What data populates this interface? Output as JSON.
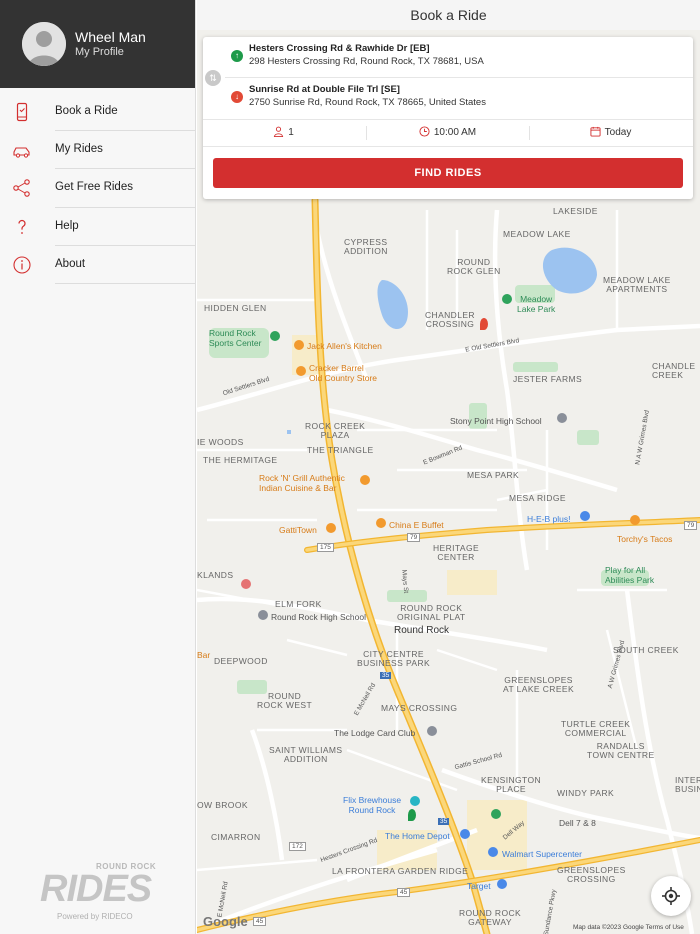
{
  "profile": {
    "name": "Wheel Man",
    "subtitle": "My Profile"
  },
  "menu": {
    "items": [
      {
        "label": "Book a Ride",
        "icon": "phone-icon"
      },
      {
        "label": "My Rides",
        "icon": "car-icon"
      },
      {
        "label": "Get Free Rides",
        "icon": "share-icon"
      },
      {
        "label": "Help",
        "icon": "question-icon"
      },
      {
        "label": "About",
        "icon": "info-icon"
      }
    ]
  },
  "brand": {
    "small": "ROUND ROCK",
    "big": "RIDES",
    "powered": "Powered by RIDECO"
  },
  "header": {
    "title": "Book a Ride"
  },
  "ride": {
    "pickup": {
      "title": "Hesters Crossing Rd & Rawhide Dr [EB]",
      "address": "298 Hesters Crossing Rd, Round Rock, TX 78681, USA",
      "color": "#1e9a4a"
    },
    "dropoff": {
      "title": "Sunrise Rd at Double File Trl [SE]",
      "address": "2750 Sunrise Rd, Round Rock, TX 78665, United States",
      "color": "#e24a36"
    },
    "passengers": "1",
    "time": "10:00 AM",
    "date": "Today",
    "find_label": "FIND RIDES"
  },
  "map": {
    "labels": {
      "lakeside": "LAKESIDE",
      "meadow_lake": "MEADOW LAKE",
      "cypress": "CYPRESS\nADDITION",
      "round_rock_glen": "ROUND\nROCK GLEN",
      "meadow_lake_apts": "MEADOW LAKE\nAPARTMENTS",
      "hidden_glen": "HIDDEN GLEN",
      "chandler_crossing": "CHANDLER\nCROSSING",
      "chandler_creek": "CHANDLE\nCREEK",
      "jester_farms": "JESTER FARMS",
      "ie_woods": "IE WOODS",
      "rock_creek_plaza": "ROCK CREEK\nPLAZA",
      "the_triangle": "THE TRIANGLE",
      "the_hermitage": "THE HERMITAGE",
      "mesa_park": "MESA PARK",
      "mesa_ridge": "MESA RIDGE",
      "heritage_center": "HERITAGE\nCENTER",
      "klands": "KLANDS",
      "elm_fork": "ELM FORK",
      "round_rock_original": "ROUND ROCK\nORIGINAL PLAT",
      "round_rock": "Round Rock",
      "deepwood": "DEEPWOOD",
      "city_centre": "CITY CENTRE\nBUSINESS PARK",
      "south_creek": "SOUTH CREEK",
      "greenslopes": "GREENSLOPES\nAT LAKE CREEK",
      "round_rock_west": "ROUND\nROCK WEST",
      "mays_crossing": "MAYS CROSSING",
      "turtle_creek": "TURTLE CREEK\nCOMMERCIAL",
      "saint_williams": "SAINT WILLIAMS\nADDITION",
      "randalls": "RANDALLS\nTOWN CENTRE",
      "kensington": "KENSINGTON\nPLACE",
      "windy_park": "WINDY PARK",
      "interchange": "INTERCHA\nBUSINESS",
      "ow_brook": "OW BROOK",
      "cimarron": "CIMARRON",
      "la_frontera": "LA FRONTERA GARDEN RIDGE",
      "greenslopes_crossing": "GREENSLOPES\nCROSSING",
      "round_rock_gateway": "ROUND ROCK\nGATEWAY"
    },
    "pois": {
      "round_rock_sports": "Round Rock\nSports Center",
      "jack_allens": "Jack Allen's Kitchen",
      "cracker_barrel": "Cracker Barrel\nOld Country Store",
      "meadow_lake_park": "Meadow\nLake Park",
      "stony_point": "Stony Point High School",
      "rock_n_grill": "Rock 'N' Grill Authentic\nIndian Cuisine & Bar",
      "heb": "H-E-B plus!",
      "china_e_buffet": "China E Buffet",
      "gattitown": "GattiTown",
      "torchys": "Torchy's Tacos",
      "play_for_all": "Play for All\nAbilities Park",
      "round_rock_high": "Round Rock High School",
      "bar": "Bar",
      "lodge_card_club": "The Lodge Card Club",
      "flix_brewhouse": "Flix Brewhouse\nRound Rock",
      "dell": "Dell 7 & 8",
      "home_depot": "The Home Depot",
      "walmart": "Walmart Supercenter",
      "target": "Target"
    },
    "roads": {
      "old_settlers_e": "E Old Settlers Blvd",
      "old_settlers_w": "Old Settlers Blvd",
      "bowman": "E Bowman Rd",
      "mays": "Mays St",
      "mcneil": "E McNeil Rd",
      "gattis": "Gattis School Rd",
      "hesters": "Hesters Crossing Rd",
      "dell_way": "Dell Way",
      "mcneil_w": "E McNeil Rd",
      "nw_grimes": "N A W Grimes Blvd",
      "aw_grimes": "A W Grimes Blvd",
      "sundance": "Sundance Pkwy",
      "shield_175": "175",
      "shield_79a": "79",
      "shield_79b": "79",
      "shield_35a": "35",
      "shield_35b": "35",
      "shield_172": "172",
      "shield_45a": "45",
      "shield_45b": "45"
    },
    "google": "Google",
    "attribution": "Map data ©2023 Google   Terms of Use",
    "colors": {
      "highway": "#f6c34a",
      "water": "#9cc3f0",
      "park": "#bfe3c4"
    }
  }
}
